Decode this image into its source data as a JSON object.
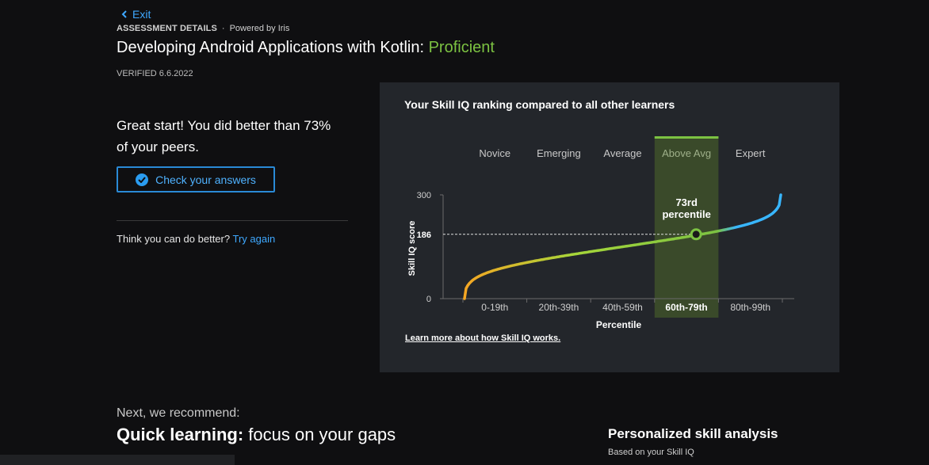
{
  "nav": {
    "exit_label": "Exit"
  },
  "breadcrumb": {
    "section": "ASSESSMENT DETAILS",
    "separator": "·",
    "powered_by": "Powered by Iris"
  },
  "assessment": {
    "title": "Developing Android Applications with Kotlin:",
    "level": "Proficient",
    "verified": "VERIFIED 6.6.2022"
  },
  "result": {
    "line1": "Great start! You did better than 73%",
    "line2": "of your peers.",
    "check_label": "Check your answers",
    "retry_prompt": "Think you can do better?",
    "retry_link": "Try again"
  },
  "panel": {
    "title": "Your Skill IQ ranking compared to all other learners",
    "learn_more": "Learn more about how Skill IQ works."
  },
  "chart_data": {
    "type": "line",
    "levels": [
      "Novice",
      "Emerging",
      "Average",
      "Above Avg",
      "Expert"
    ],
    "highlight_level": "Above Avg",
    "categories": [
      "0-19th",
      "20th-39th",
      "40th-59th",
      "60th-79th",
      "80th-99th"
    ],
    "highlight_category": "60th-79th",
    "xlabel": "Percentile",
    "ylabel": "Skill IQ score",
    "yticks": [
      0,
      300
    ],
    "ylim": [
      0,
      300
    ],
    "marker": {
      "percentile": 73,
      "score": 186,
      "score_label": "186",
      "label_line1": "73rd",
      "label_line2": "percentile"
    },
    "curve_colors": [
      "#f5a623",
      "#a6d63a",
      "#7cc242",
      "#38b6ff"
    ],
    "highlight_color": "#3a4a2a",
    "accent_color": "#7cc242"
  },
  "recommend": {
    "intro": "Next, we recommend:",
    "heading_bold": "Quick learning:",
    "heading_rest": " focus on your gaps",
    "side_title": "Personalized skill analysis",
    "side_sub": "Based on your Skill IQ"
  }
}
